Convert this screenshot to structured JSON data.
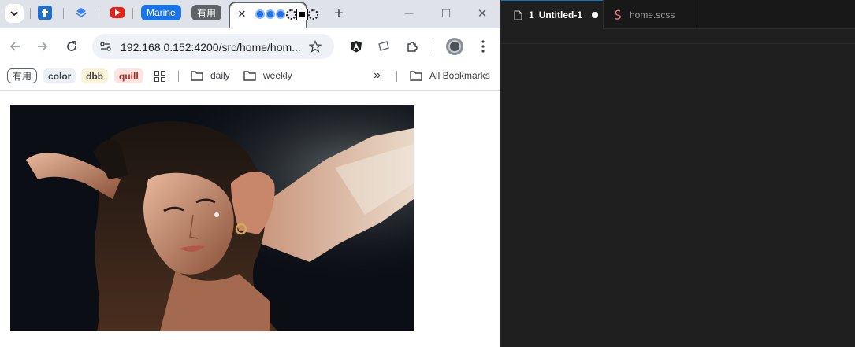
{
  "browser": {
    "tabs": {
      "pinned_badge_marine": "Marine",
      "pinned_badge_youyong": "有用",
      "close_glyph": "✕",
      "new_tab_glyph": "+"
    },
    "window_controls": {
      "minimize": "—",
      "maximize": "☐",
      "close": "✕"
    },
    "toolbar": {
      "url": "192.168.0.152:4200/src/home/hom..."
    },
    "bookmarks_bar": {
      "chips": [
        {
          "label": "有用",
          "color": "#3c4043",
          "bg": "#ffffff",
          "border": "#5f6368"
        },
        {
          "label": "color",
          "color": "#3c4043",
          "bg": "#eceff3"
        },
        {
          "label": "dbb",
          "color": "#3c4043",
          "bg": "#fdf3d6"
        },
        {
          "label": "quill",
          "color": "#b3261e",
          "bg": "#fce4e2"
        }
      ],
      "folders": [
        {
          "label": "daily"
        },
        {
          "label": "weekly"
        }
      ],
      "overflow_glyph": "»",
      "all_bookmarks": "All Bookmarks"
    },
    "page": {
      "image_alt": "Portrait photo of a woman with long dark hair, arms raised behind her head"
    }
  },
  "editor": {
    "tabs": [
      {
        "number": "1",
        "label": "Untitled-1",
        "modified": true,
        "active": true
      },
      {
        "label": "home.scss",
        "active": false
      }
    ],
    "colors": {
      "background": "#1f1f1f",
      "tab_bar": "#181818",
      "accent": "#0078d4",
      "scss": "#e06c75"
    }
  }
}
